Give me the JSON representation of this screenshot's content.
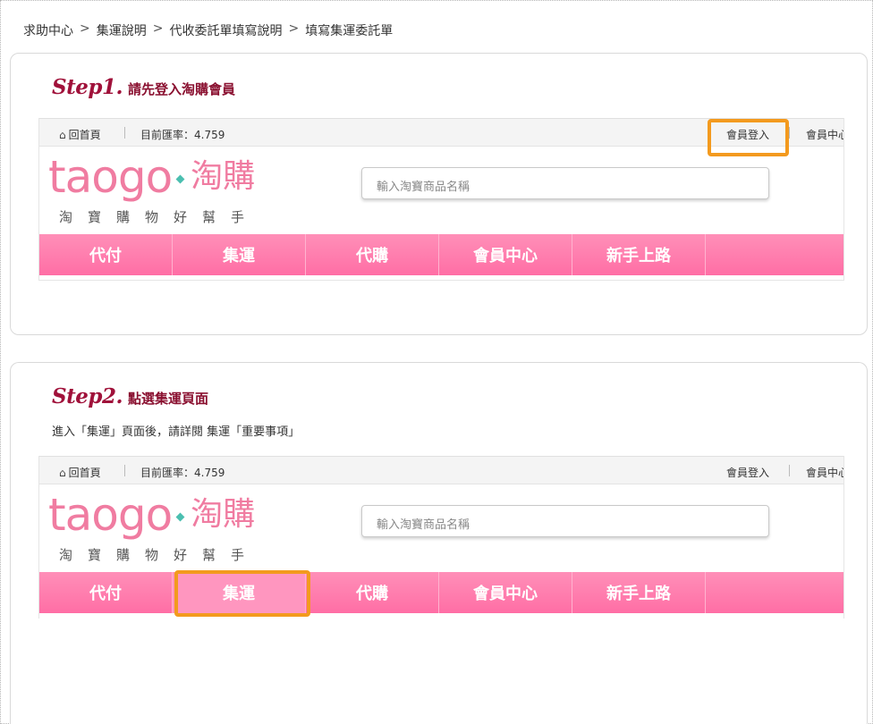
{
  "breadcrumb": {
    "items": [
      "求助中心",
      "集運說明",
      "代收委託單填寫說明",
      "填寫集運委託單"
    ],
    "separator": ">"
  },
  "steps": [
    {
      "label": "Step1.",
      "title": "請先登入淘購會員",
      "note": "",
      "highlight": "會員登入"
    },
    {
      "label": "Step2.",
      "title": "點選集運頁面",
      "note": "進入「集運」頁面後，請詳閱 集運「重要事項」",
      "highlight": "集運"
    }
  ],
  "site": {
    "home_label": "回首頁",
    "rate_label": "目前匯率：4.759",
    "login_label": "會員登入",
    "member_label": "會員中心",
    "logo_latin": "taogo",
    "logo_cjk": "淘購",
    "slogan": "淘寶購物好幫手",
    "search_placeholder": "輸入淘寶商品名稱",
    "nav": [
      "代付",
      "集運",
      "代購",
      "會員中心",
      "新手上路"
    ]
  },
  "colors": {
    "accent_title": "#a0113a",
    "brand_pink": "#f07ca1",
    "nav_pink": "#ff7aab",
    "highlight_orange": "#f39a1e",
    "logo_dot_teal": "#4bbfb0"
  },
  "icons": {
    "home": "home-icon"
  }
}
